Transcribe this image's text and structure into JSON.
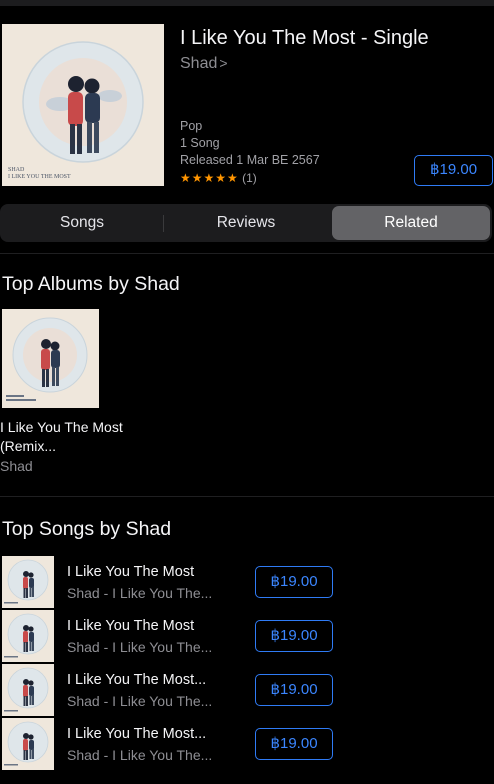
{
  "header": {
    "title": "I Like You The Most - Single",
    "artist": "Shad",
    "artist_chevron": ">",
    "cover_text": "SHAD\nI LIKE YOU THE MOST",
    "genre": "Pop",
    "song_count": "1 Song",
    "released": "Released 1 Mar BE 2567",
    "stars": "★★★★★",
    "rating_count": "(1)",
    "price": "฿19.00"
  },
  "tabs": [
    {
      "label": "Songs",
      "selected": false
    },
    {
      "label": "Reviews",
      "selected": false
    },
    {
      "label": "Related",
      "selected": true
    }
  ],
  "top_albums": {
    "heading": "Top Albums by Shad",
    "items": [
      {
        "name": "I Like You The Most (Remix...",
        "artist": "Shad"
      }
    ]
  },
  "top_songs": {
    "heading": "Top Songs by Shad",
    "items": [
      {
        "title": "I Like You The Most",
        "subtitle": "Shad - I Like You The...",
        "price": "฿19.00"
      },
      {
        "title": "I Like You The Most",
        "subtitle": "Shad - I Like You The...",
        "price": "฿19.00"
      },
      {
        "title": "I Like You The Most...",
        "subtitle": "Shad - I Like You The...",
        "price": "฿19.00"
      },
      {
        "title": "I Like You The Most...",
        "subtitle": "Shad - I Like You The...",
        "price": "฿19.00"
      }
    ]
  },
  "colors": {
    "background": "#000000",
    "accent_blue": "#2f7bf5",
    "star_orange": "#ff9500",
    "secondary_text": "#8e8e93",
    "segment_selected": "#636366"
  }
}
